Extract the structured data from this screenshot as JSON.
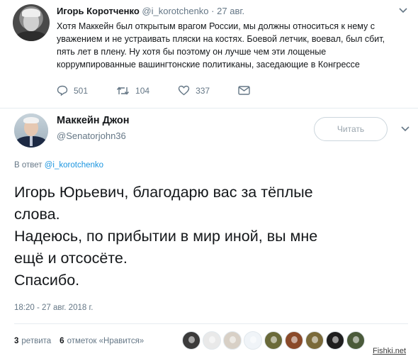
{
  "quoted_tweet": {
    "author_name": "Игорь Коротченко",
    "handle": "@i_korotchenko",
    "separator": "·",
    "date": "27 авг.",
    "text": "Хотя Маккейн был открытым врагом России, мы должны относиться к нему с уважением и не устраивать пляски на костях. Боевой летчик, воевал, был сбит, пять лет в плену. Ну хотя бы поэтому он лучше чем эти лощеные коррумпированные вашингтонские политиканы, заседающие в Конгрессе",
    "actions": [
      {
        "icon": "reply-icon",
        "count": "501"
      },
      {
        "icon": "retweet-icon",
        "count": "104"
      },
      {
        "icon": "heart-icon",
        "count": "337"
      },
      {
        "icon": "message-icon",
        "count": ""
      }
    ]
  },
  "main_tweet": {
    "author_name": "Маккейн Джон",
    "handle": "@Senatorjohn36",
    "follow_label": "Читать",
    "reply_prefix": "В ответ",
    "reply_handle": "@i_korotchenko",
    "text_lines": [
      "Игорь Юрьевич, благодарю вас за тёплые",
      "слова.",
      "Надеюсь, по прибытии в мир иной, вы мне",
      "ещё и отсосёте.",
      "Спасибо."
    ],
    "timestamp": "18:20 - 27 авг. 2018 г.",
    "retweets_count": "3",
    "retweets_label": "ретвита",
    "likes_count": "6",
    "likes_label": "отметок «Нравится»",
    "liker_avatars": [
      "#3b3b3b",
      "#e9e9e9",
      "#d8d0c6",
      "#f0f4f8",
      "#6a6a3a",
      "#8a4a2a",
      "#7a6a3a",
      "#1e1e1e",
      "#4a5a3a"
    ]
  },
  "watermark": "Fishki.net",
  "colors": {
    "text": "#14171a",
    "secondary": "#657786",
    "link": "#1b95e0",
    "border": "#e6ecf0"
  }
}
